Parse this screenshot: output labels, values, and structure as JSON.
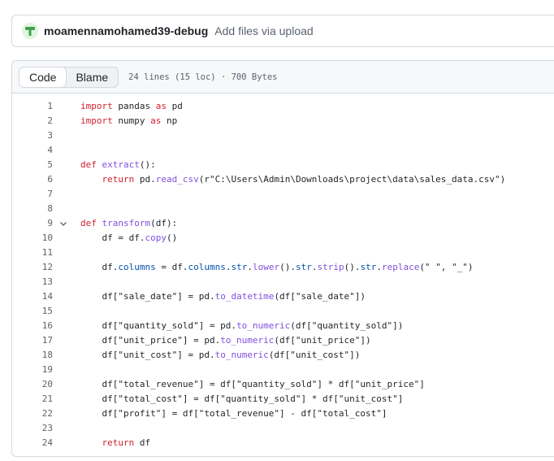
{
  "commit": {
    "author": "moamennamohamed39-debug",
    "message": "Add files via upload"
  },
  "file": {
    "tabs": [
      "Code",
      "Blame"
    ],
    "meta": "24 lines (15 loc) · 700 Bytes"
  },
  "code_lines": [
    {
      "n": "1",
      "tokens": [
        {
          "t": "import",
          "c": "kw"
        },
        {
          "t": " pandas "
        },
        {
          "t": "as",
          "c": "kw"
        },
        {
          "t": " pd"
        }
      ]
    },
    {
      "n": "2",
      "tokens": [
        {
          "t": "import",
          "c": "kw"
        },
        {
          "t": " numpy "
        },
        {
          "t": "as",
          "c": "kw"
        },
        {
          "t": " np"
        }
      ]
    },
    {
      "n": "3",
      "tokens": []
    },
    {
      "n": "4",
      "tokens": []
    },
    {
      "n": "5",
      "tokens": [
        {
          "t": "def",
          "c": "kw"
        },
        {
          "t": " "
        },
        {
          "t": "extract",
          "c": "fn"
        },
        {
          "t": "():"
        }
      ]
    },
    {
      "n": "6",
      "tokens": [
        {
          "t": "    "
        },
        {
          "t": "return",
          "c": "kw"
        },
        {
          "t": " pd."
        },
        {
          "t": "read_csv",
          "c": "fn"
        },
        {
          "t": "(r\"C:\\Users\\Admin\\Downloads\\project\\data\\sales_data.csv\")"
        }
      ]
    },
    {
      "n": "7",
      "tokens": []
    },
    {
      "n": "8",
      "tokens": []
    },
    {
      "n": "9",
      "fold": true,
      "tokens": [
        {
          "t": "def",
          "c": "kw"
        },
        {
          "t": " "
        },
        {
          "t": "transform",
          "c": "fn"
        },
        {
          "t": "(df):"
        }
      ]
    },
    {
      "n": "10",
      "tokens": [
        {
          "t": "    df = df."
        },
        {
          "t": "copy",
          "c": "fn"
        },
        {
          "t": "()"
        }
      ]
    },
    {
      "n": "11",
      "tokens": []
    },
    {
      "n": "12",
      "tokens": [
        {
          "t": "    df."
        },
        {
          "t": "columns",
          "c": "attr"
        },
        {
          "t": " = df."
        },
        {
          "t": "columns",
          "c": "attr"
        },
        {
          "t": "."
        },
        {
          "t": "str",
          "c": "attr"
        },
        {
          "t": "."
        },
        {
          "t": "lower",
          "c": "fn"
        },
        {
          "t": "()."
        },
        {
          "t": "str",
          "c": "attr"
        },
        {
          "t": "."
        },
        {
          "t": "strip",
          "c": "fn"
        },
        {
          "t": "()."
        },
        {
          "t": "str",
          "c": "attr"
        },
        {
          "t": "."
        },
        {
          "t": "replace",
          "c": "fn"
        },
        {
          "t": "(\" \", \"_\")"
        }
      ]
    },
    {
      "n": "13",
      "tokens": []
    },
    {
      "n": "14",
      "tokens": [
        {
          "t": "    df[\"sale_date\"] = pd."
        },
        {
          "t": "to_datetime",
          "c": "fn"
        },
        {
          "t": "(df[\"sale_date\"])"
        }
      ]
    },
    {
      "n": "15",
      "tokens": []
    },
    {
      "n": "16",
      "tokens": [
        {
          "t": "    df[\"quantity_sold\"] = pd."
        },
        {
          "t": "to_numeric",
          "c": "fn"
        },
        {
          "t": "(df[\"quantity_sold\"])"
        }
      ]
    },
    {
      "n": "17",
      "tokens": [
        {
          "t": "    df[\"unit_price\"] = pd."
        },
        {
          "t": "to_numeric",
          "c": "fn"
        },
        {
          "t": "(df[\"unit_price\"])"
        }
      ]
    },
    {
      "n": "18",
      "tokens": [
        {
          "t": "    df[\"unit_cost\"] = pd."
        },
        {
          "t": "to_numeric",
          "c": "fn"
        },
        {
          "t": "(df[\"unit_cost\"])"
        }
      ]
    },
    {
      "n": "19",
      "tokens": []
    },
    {
      "n": "20",
      "tokens": [
        {
          "t": "    df[\"total_revenue\"] = df[\"quantity_sold\"] * df[\"unit_price\"]"
        }
      ]
    },
    {
      "n": "21",
      "tokens": [
        {
          "t": "    df[\"total_cost\"] = df[\"quantity_sold\"] * df[\"unit_cost\"]"
        }
      ]
    },
    {
      "n": "22",
      "tokens": [
        {
          "t": "    df[\"profit\"] = df[\"total_revenue\"] - df[\"total_cost\"]"
        }
      ]
    },
    {
      "n": "23",
      "tokens": []
    },
    {
      "n": "24",
      "tokens": [
        {
          "t": "    "
        },
        {
          "t": "return",
          "c": "kw"
        },
        {
          "t": " df"
        }
      ]
    }
  ],
  "icons": {
    "avatar": "tree-avatar-icon",
    "fold": "chevron-down-icon"
  },
  "colors": {
    "keyword": "#cf222e",
    "function": "#8250df",
    "attribute": "#0550ae",
    "line_number": "#59636e"
  }
}
